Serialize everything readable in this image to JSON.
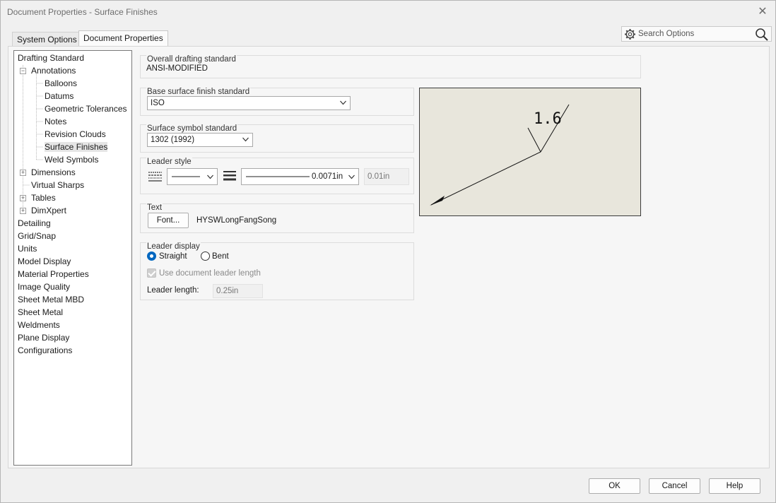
{
  "window": {
    "title": "Document Properties - Surface Finishes",
    "close_glyph": "✕"
  },
  "tabs": [
    {
      "label": "System Options",
      "active": false
    },
    {
      "label": "Document Properties",
      "active": true
    }
  ],
  "search": {
    "placeholder": "Search Options"
  },
  "tree": {
    "items": [
      {
        "label": "Drafting Standard"
      },
      {
        "label": "Annotations",
        "expander": "−"
      },
      {
        "label": "Balloons"
      },
      {
        "label": "Datums"
      },
      {
        "label": "Geometric Tolerances"
      },
      {
        "label": "Notes"
      },
      {
        "label": "Revision Clouds"
      },
      {
        "label": "Surface Finishes",
        "selected": true
      },
      {
        "label": "Weld Symbols"
      },
      {
        "label": "Dimensions",
        "expander": "+"
      },
      {
        "label": "Virtual Sharps"
      },
      {
        "label": "Tables",
        "expander": "+"
      },
      {
        "label": "DimXpert",
        "expander": "+"
      },
      {
        "label": "Detailing"
      },
      {
        "label": "Grid/Snap"
      },
      {
        "label": "Units"
      },
      {
        "label": "Model Display"
      },
      {
        "label": "Material Properties"
      },
      {
        "label": "Image Quality"
      },
      {
        "label": "Sheet Metal MBD"
      },
      {
        "label": "Sheet Metal"
      },
      {
        "label": "Weldments"
      },
      {
        "label": "Plane Display"
      },
      {
        "label": "Configurations"
      }
    ]
  },
  "overall": {
    "label": "Overall drafting standard",
    "value": "ANSI-MODIFIED"
  },
  "base_surface": {
    "label": "Base surface finish standard",
    "value": "ISO"
  },
  "surface_symbol": {
    "label": "Surface symbol standard",
    "value": "1302 (1992)"
  },
  "leader_style": {
    "label": "Leader style",
    "thickness_value": "0.0071in",
    "custom_thickness": "0.01in"
  },
  "text": {
    "label": "Text",
    "font_button": "Font...",
    "font_name": "HYSWLongFangSong"
  },
  "leader_display": {
    "label": "Leader display",
    "straight": "Straight",
    "bent": "Bent",
    "use_doc_length": "Use document leader length",
    "length_label": "Leader length:",
    "length_value": "0.25in"
  },
  "preview": {
    "symbol_value": "1.6"
  },
  "footer": {
    "ok": "OK",
    "cancel": "Cancel",
    "help": "Help"
  },
  "colors": {
    "accent": "#0067c0",
    "preview_bg": "#e8e6dc"
  }
}
